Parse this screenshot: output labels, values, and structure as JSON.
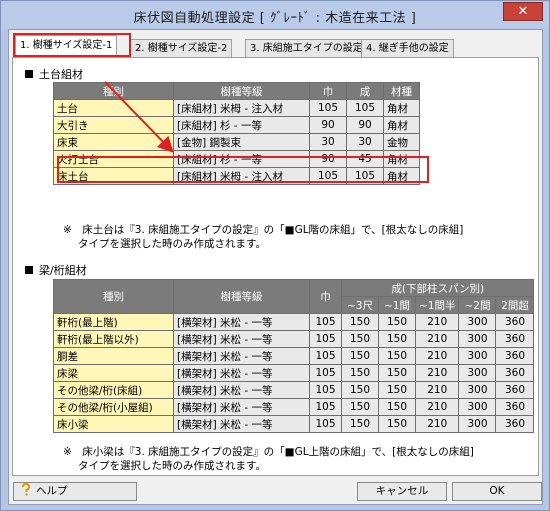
{
  "window": {
    "title": "床伏図自動処理設定 [ ｸﾞﾚｰﾄﾞ : 木造在来工法 ]",
    "close_glyph": "✕"
  },
  "tabs": [
    {
      "label": "1. 樹種サイズ設定-1",
      "active": true
    },
    {
      "label": "2. 樹種サイズ設定-2",
      "active": false
    },
    {
      "label": "3. 床組施工タイプの設定",
      "active": false
    },
    {
      "label": "4. 継ぎ手他の設定",
      "active": false
    }
  ],
  "section1": {
    "title": "土台組材",
    "headers": [
      "種別",
      "樹種等級",
      "巾",
      "成",
      "材種"
    ],
    "rows": [
      [
        "土台",
        "[床組材] 米栂 - 注入材",
        "105",
        "105",
        "角材"
      ],
      [
        "大引き",
        "[床組材] 杉 - 一等",
        "90",
        "90",
        "角材"
      ],
      [
        "床束",
        "[金物] 鋼製束",
        "30",
        "30",
        "金物"
      ],
      [
        "火打土台",
        "[床組材] 杉 - 一等",
        "90",
        "45",
        "角材"
      ],
      [
        "床土台",
        "[床組材] 米栂 - 注入材",
        "105",
        "105",
        "角材"
      ]
    ],
    "note_line1": "※　床土台は『3. 床組施工タイプの設定』の「■GL階の床組」で、[根太なしの床組]",
    "note_line2": "タイプを選択した時のみ作成されます。"
  },
  "section2": {
    "title": "梁/桁組材",
    "headers": {
      "kind": "種別",
      "grade": "樹種等級",
      "width": "巾",
      "height_group": "成(下部柱スパン別)",
      "spans": [
        "~3尺",
        "~1間",
        "~1間半",
        "~2間",
        "2間超"
      ]
    },
    "rows": [
      [
        "軒桁(最上階)",
        "[横架材] 米松 - 一等",
        "105",
        "150",
        "150",
        "210",
        "300",
        "360"
      ],
      [
        "軒桁(最上階以外)",
        "[横架材] 米松 - 一等",
        "105",
        "150",
        "150",
        "210",
        "300",
        "360"
      ],
      [
        "胴差",
        "[横架材] 米松 - 一等",
        "105",
        "150",
        "150",
        "210",
        "300",
        "360"
      ],
      [
        "床梁",
        "[横架材] 米松 - 一等",
        "105",
        "150",
        "150",
        "210",
        "300",
        "360"
      ],
      [
        "その他梁/桁(床組)",
        "[横架材] 米松 - 一等",
        "105",
        "150",
        "150",
        "210",
        "300",
        "360"
      ],
      [
        "その他梁/桁(小屋組)",
        "[横架材] 米松 - 一等",
        "105",
        "150",
        "150",
        "210",
        "300",
        "360"
      ],
      [
        "床小梁",
        "[横架材] 米松 - 一等",
        "105",
        "150",
        "150",
        "210",
        "300",
        "360"
      ]
    ],
    "note_line1": "※　床小梁は『3. 床組施工タイプの設定』の「■GL上階の床組」で、[根太なしの床組]",
    "note_line2": "タイプを選択した時のみ作成されます。"
  },
  "buttons": {
    "help": "ヘルプ",
    "cancel": "キャンセル",
    "ok": "OK"
  },
  "colors": {
    "highlight": "#e02020",
    "header_bg": "#7b7b7b",
    "name_cell_bg": "#fff6b8",
    "value_cell_bg": "#e9e9e9"
  }
}
